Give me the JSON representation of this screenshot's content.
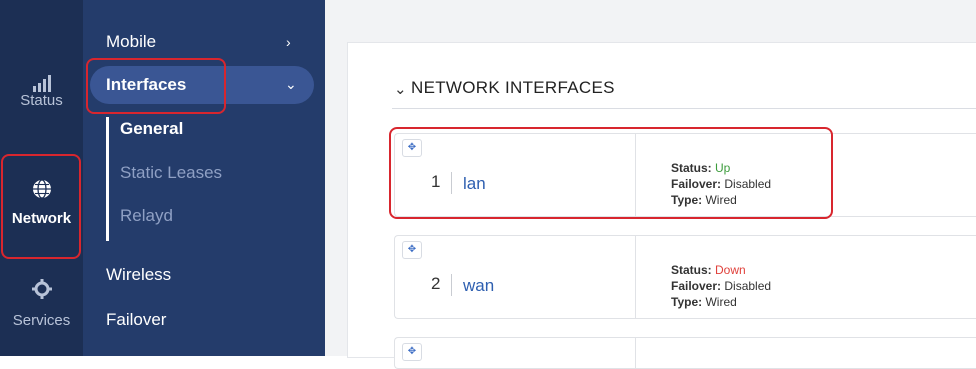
{
  "rail": {
    "status_label": "Status",
    "network_label": "Network",
    "services_label": "Services"
  },
  "submenu": {
    "mobile": "Mobile",
    "interfaces": "Interfaces",
    "general": "General",
    "static_leases": "Static Leases",
    "relayd": "Relayd",
    "wireless": "Wireless",
    "failover": "Failover"
  },
  "main": {
    "section_title": "NETWORK INTERFACES",
    "rows": [
      {
        "index": "1",
        "name": "lan",
        "status_key": "Status:",
        "status": "Up",
        "failover_key": "Failover:",
        "failover": "Disabled",
        "type_key": "Type:",
        "type": "Wired"
      },
      {
        "index": "2",
        "name": "wan",
        "status_key": "Status:",
        "status": "Down",
        "failover_key": "Failover:",
        "failover": "Disabled",
        "type_key": "Type:",
        "type": "Wired"
      }
    ]
  },
  "colors": {
    "rail_bg": "#1c2f54",
    "submenu_bg": "#243c6b",
    "highlight": "#d8262e",
    "status_up": "#3c9c3c",
    "status_down": "#e0413b"
  }
}
